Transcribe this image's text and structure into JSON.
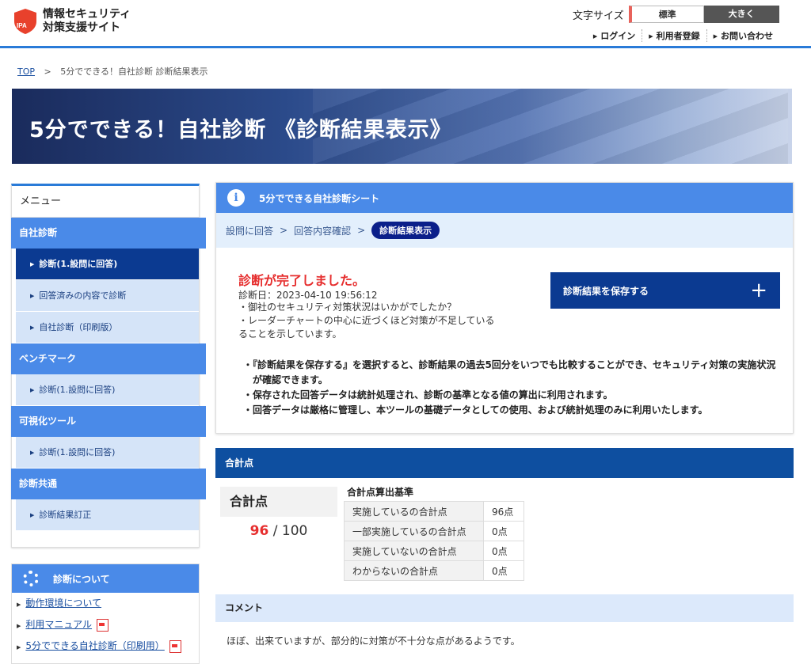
{
  "header": {
    "logo_badge": "IPA",
    "logo_line1": "情報セキュリティ",
    "logo_line2": "対策支援サイト",
    "font_size_label": "文字サイズ",
    "font_size_standard": "標準",
    "font_size_large": "大きく",
    "links": [
      "ログイン",
      "利用者登録",
      "お問い合わせ"
    ]
  },
  "breadcrumb": {
    "top": "TOP",
    "separator": ">",
    "current": "5分でできる！自社診断 診断結果表示"
  },
  "banner": {
    "title": "5分でできる！自社診断 《診断結果表示》"
  },
  "sidebar": {
    "menu_title": "メニュー",
    "sections": [
      {
        "label": "自社診断",
        "items": [
          "診断(1.設問に回答)",
          "回答済みの内容で診断",
          "自社診断（印刷版）"
        ]
      },
      {
        "label": "ベンチマーク",
        "items": [
          "診断(1.設問に回答)"
        ]
      },
      {
        "label": "可視化ツール",
        "items": [
          "診断(1.設問に回答)"
        ]
      },
      {
        "label": "診断共通",
        "items": [
          "診断結果訂正"
        ]
      }
    ],
    "about": {
      "title": "診断について",
      "links": [
        "動作環境について",
        "利用マニュアル",
        "5分でできる自社診断（印刷用）"
      ]
    }
  },
  "panel": {
    "title": "5分でできる自社診断シート",
    "steps": [
      "設問に回答",
      "回答内容確認",
      "診断結果表示"
    ],
    "step_separator": ">",
    "done_title": "診断が完了しました。",
    "diagnosis_date": "診断日：2023-04-10 19:56:12",
    "message_lines": [
      "・御社のセキュリティ対策状況はいかがでしたか？",
      "・レーダーチャートの中心に近づくほど対策が不足している",
      "ることを示しています。"
    ],
    "save_button": "診断結果を保存する",
    "save_icon": "+",
    "notes": [
      "・『診断結果を保存する』を選択すると、診断結果の過去5回分をいつでも比較することができ、セキュリティ対策の実施状況が確認できます。",
      "・保存された回答データは統計処理され、診断の基準となる値の算出に利用されます。",
      "・回答データは厳格に管理し、本ツールの基礎データとしての使用、および統計処理のみに利用いたします。"
    ]
  },
  "score": {
    "section_title": "合計点",
    "box_label": "合計点",
    "value": "96",
    "separator": "/",
    "max": "100",
    "criteria_title": "合計点算出基準",
    "criteria": [
      {
        "label": "実施しているの合計点",
        "value": "96点"
      },
      {
        "label": "一部実施しているの合計点",
        "value": "0点"
      },
      {
        "label": "実施していないの合計点",
        "value": "0点"
      },
      {
        "label": "わからないの合計点",
        "value": "0点"
      }
    ]
  },
  "comment": {
    "title": "コメント",
    "text": "ほぼ、出来ていますが、部分的に対策が不十分な点があるようです。"
  },
  "colors": {
    "accent": "#4a8ae8",
    "dark_blue": "#0b3a91",
    "alert": "#e62e2e"
  }
}
